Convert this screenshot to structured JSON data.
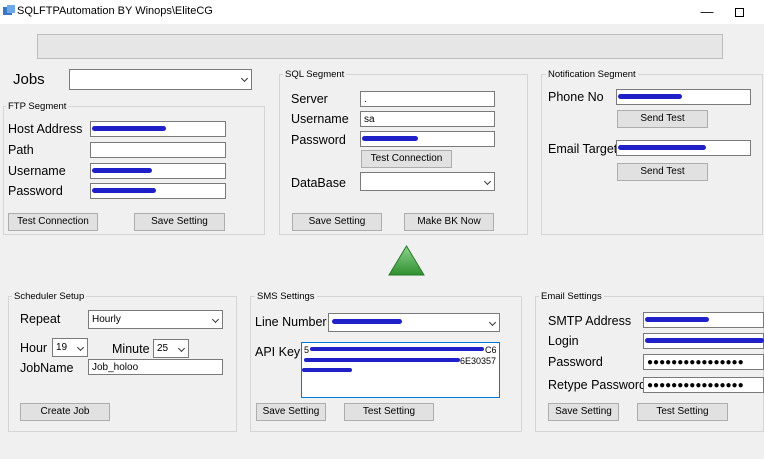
{
  "window": {
    "title": "SQLFTPAutomation BY Winops\\EliteCG",
    "minimize_glyph": "—",
    "icons": {
      "app": "app-icon",
      "minimize": "minimize-icon",
      "maximize": "maximize-icon"
    }
  },
  "progress": {
    "value": 0
  },
  "jobs": {
    "label": "Jobs",
    "value": ""
  },
  "ftp": {
    "title": "FTP Segment",
    "host_label": "Host Address",
    "host_value": "",
    "path_label": "Path",
    "path_value": "",
    "username_label": "Username",
    "username_value": "",
    "password_label": "Password",
    "password_value": "",
    "test_button": "Test Connection",
    "save_button": "Save Setting"
  },
  "sql": {
    "title": "SQL Segment",
    "server_label": "Server",
    "server_value": ".",
    "username_label": "Username",
    "username_value": "sa",
    "password_label": "Password",
    "password_value": "",
    "test_button": "Test Connection",
    "database_label": "DataBase",
    "database_value": "",
    "save_button": "Save Setting",
    "backup_button": "Make BK Now"
  },
  "notification": {
    "title": "Notification Segment",
    "phone_label": "Phone No",
    "phone_value": "",
    "send_test_1": "Send Test",
    "email_label": "Email Target",
    "email_value": "",
    "send_test_2": "Send Test"
  },
  "run_icon": {
    "name": "triangle-up-icon",
    "color": "#3aa03a"
  },
  "scheduler": {
    "title": "Scheduler Setup",
    "repeat_label": "Repeat",
    "repeat_value": "Hourly",
    "hour_label": "Hour",
    "hour_value": "19",
    "minute_label": "Minute",
    "minute_value": "25",
    "jobname_label": "JobName",
    "jobname_value": "Job_holoo",
    "create_button": "Create Job"
  },
  "sms": {
    "title": "SMS Settings",
    "line_label": "Line Number",
    "line_value": "",
    "api_label": "API Key",
    "api_line1": "5",
    "api_line1_tail": "C6",
    "api_line2_tail": "6E30357",
    "save_button": "Save Setting",
    "test_button": "Test Setting"
  },
  "email": {
    "title": "Email Settings",
    "smtp_label": "SMTP Address",
    "smtp_value": "",
    "login_label": "Login",
    "login_value": "",
    "password_label": "Password",
    "password_value": "●●●●●●●●●●●●●●●●",
    "retype_label": "Retype Password",
    "retype_value": "●●●●●●●●●●●●●●●●",
    "save_button": "Save Setting",
    "test_button": "Test Setting"
  }
}
